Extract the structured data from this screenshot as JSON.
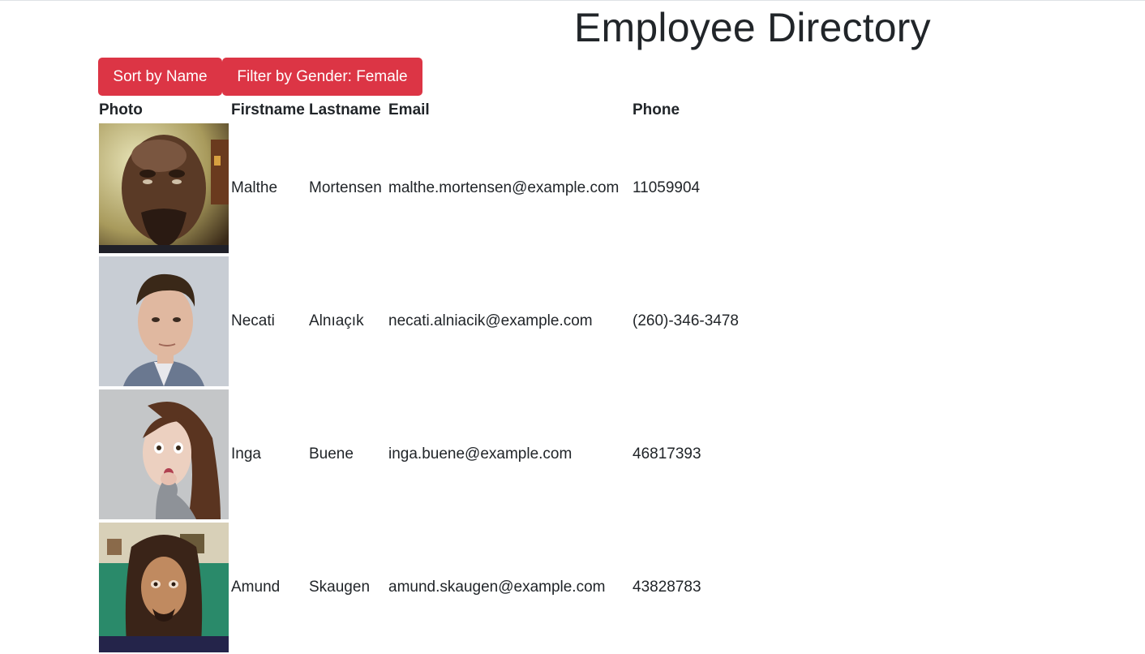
{
  "page": {
    "title": "Employee Directory"
  },
  "toolbar": {
    "sort_label": "Sort by Name",
    "filter_label": "Filter by Gender: Female",
    "button_color": "#dc3545"
  },
  "table": {
    "headers": {
      "photo": "Photo",
      "firstname": "Firstname",
      "lastname": "Lastname",
      "email": "Email",
      "phone": "Phone"
    },
    "rows": [
      {
        "firstname": "Malthe",
        "lastname": "Mortensen",
        "email": "malthe.mortensen@example.com",
        "phone": "11059904"
      },
      {
        "firstname": "Necati",
        "lastname": "Alnıaçık",
        "email": "necati.alniacik@example.com",
        "phone": "(260)-346-3478"
      },
      {
        "firstname": "Inga",
        "lastname": "Buene",
        "email": "inga.buene@example.com",
        "phone": "46817393"
      },
      {
        "firstname": "Amund",
        "lastname": "Skaugen",
        "email": "amund.skaugen@example.com",
        "phone": "43828783"
      }
    ]
  }
}
